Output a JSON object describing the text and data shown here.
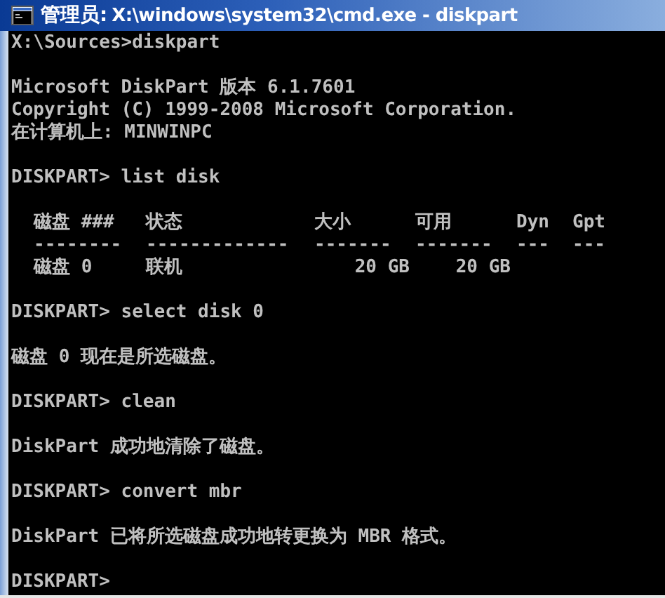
{
  "window": {
    "title_prefix": "管理员:",
    "title": "X:\\windows\\system32\\cmd.exe - diskpart"
  },
  "console": [
    {
      "kind": "line",
      "text": "X:\\Sources>diskpart"
    },
    {
      "kind": "blank"
    },
    {
      "kind": "line",
      "text": "Microsoft DiskPart 版本 6.1.7601"
    },
    {
      "kind": "line",
      "text": "Copyright (C) 1999-2008 Microsoft Corporation."
    },
    {
      "kind": "line",
      "text": "在计算机上: MINWINPC"
    },
    {
      "kind": "blank"
    },
    {
      "kind": "line",
      "text": "DISKPART> list disk"
    },
    {
      "kind": "blank"
    },
    {
      "kind": "table",
      "columns": [
        {
          "label": "磁盘 ###",
          "rule": "--------"
        },
        {
          "label": "状态",
          "rule": "-------------"
        },
        {
          "label": "大小",
          "rule": "-------"
        },
        {
          "label": "可用",
          "rule": "-------"
        },
        {
          "label": "Dyn",
          "rule": "---"
        },
        {
          "label": "Gpt",
          "rule": "---"
        }
      ],
      "rows": [
        [
          "磁盘 0",
          "联机",
          "20 GB",
          "20 GB"
        ]
      ]
    },
    {
      "kind": "blank"
    },
    {
      "kind": "line",
      "text": "DISKPART> select disk 0"
    },
    {
      "kind": "blank"
    },
    {
      "kind": "line",
      "text": "磁盘 0 现在是所选磁盘。"
    },
    {
      "kind": "blank"
    },
    {
      "kind": "line",
      "text": "DISKPART> clean"
    },
    {
      "kind": "blank"
    },
    {
      "kind": "line",
      "text": "DiskPart 成功地清除了磁盘。"
    },
    {
      "kind": "blank"
    },
    {
      "kind": "line",
      "text": "DISKPART> convert mbr"
    },
    {
      "kind": "blank"
    },
    {
      "kind": "line",
      "text": "DiskPart 已将所选磁盘成功地转更换为 MBR 格式。"
    },
    {
      "kind": "blank"
    },
    {
      "kind": "line",
      "text": "DISKPART>"
    }
  ]
}
